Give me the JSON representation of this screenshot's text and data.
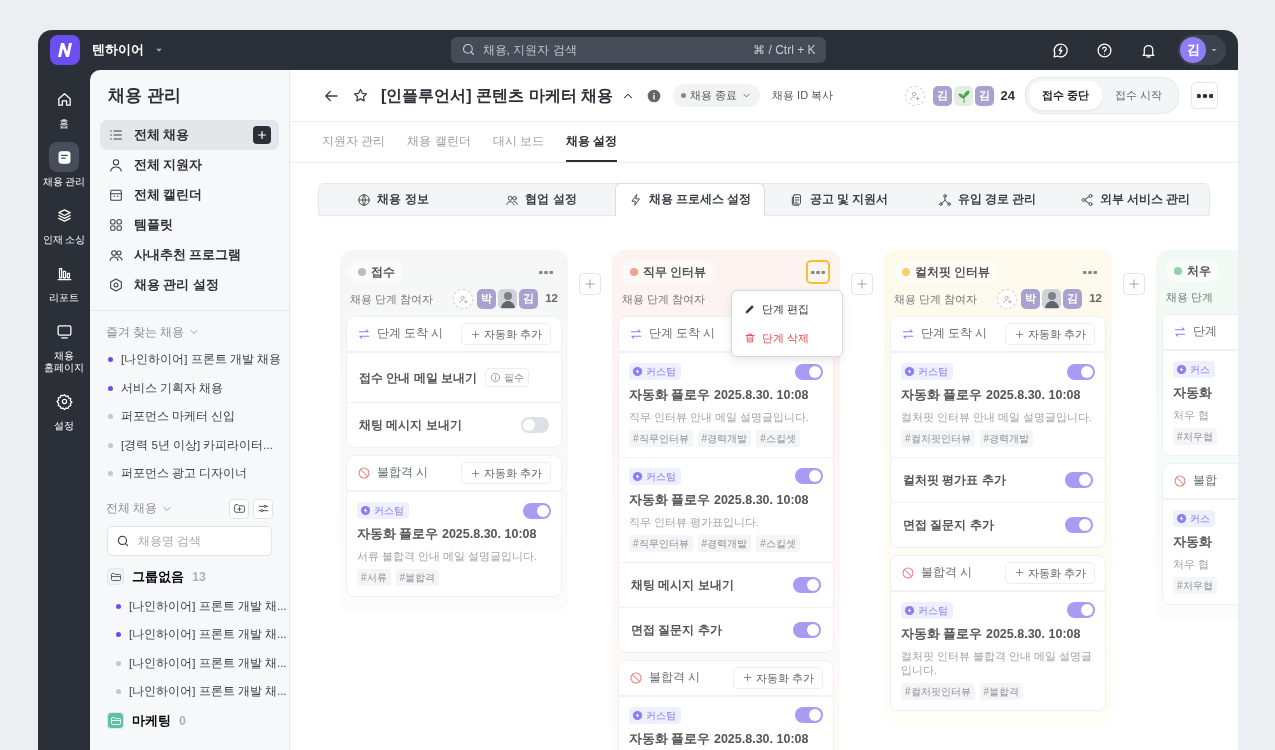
{
  "app": {
    "workspace": "텐하이어",
    "search_placeholder": "채용, 지원자 검색",
    "search_shortcut": "⌘ / Ctrl + K",
    "user_initial": "김"
  },
  "rail": [
    {
      "label": "홈",
      "selected": false
    },
    {
      "label": "채용 관리",
      "selected": true
    },
    {
      "label": "인재 소싱",
      "selected": false
    },
    {
      "label": "리포트",
      "selected": false
    },
    {
      "label": "채용 홈페이지",
      "selected": false
    },
    {
      "label": "설정",
      "selected": false
    }
  ],
  "sidebar": {
    "title": "채용 관리",
    "nav": [
      {
        "label": "전체 채용",
        "selected": true,
        "add": true
      },
      {
        "label": "전체 지원자",
        "selected": false,
        "add": false
      },
      {
        "label": "전체 캘린더",
        "selected": false,
        "add": false
      },
      {
        "label": "템플릿",
        "selected": false,
        "add": false
      },
      {
        "label": "사내추천 프로그램",
        "selected": false,
        "add": false
      },
      {
        "label": "채용 관리 설정",
        "selected": false,
        "add": false
      }
    ],
    "favorites_title": "즐겨 찾는 채용",
    "favorites": [
      {
        "label": "[나인하이어] 프론트 개발 채용",
        "color": "#6a4cf0"
      },
      {
        "label": "서비스 기획자 채용",
        "color": "#6a4cf0"
      },
      {
        "label": "퍼포먼스 마케터 신입",
        "color": "#c4c6cb"
      },
      {
        "label": "[경력 5년 이상] 카피라이터...",
        "color": "#c4c6cb"
      },
      {
        "label": "퍼포먼스 광고 디자이너",
        "color": "#c4c6cb"
      }
    ],
    "all_title": "전체 채용",
    "all_search_placeholder": "채용명 검색",
    "groups": [
      {
        "name": "그룹없음",
        "count": "13",
        "color": "#f1f2f4",
        "children": [
          {
            "label": "[나인하이어] 프론트 개발 채...",
            "color": "#6a4cf0"
          },
          {
            "label": "[나인하이어] 프론트 개발 채...",
            "color": "#6a4cf0"
          },
          {
            "label": "[나인하이어] 프론트 개발 채...",
            "color": "#c4c6cb"
          },
          {
            "label": "[나인하이어] 프론트 개발 채...",
            "color": "#c4c6cb"
          }
        ]
      },
      {
        "name": "마케팅",
        "count": "0",
        "color": "#5cc2a5"
      }
    ]
  },
  "header": {
    "title": "[인플루언서] 콘텐츠 마케터 채용",
    "status": "채용 종료",
    "copy_id": "채용 ID 복사",
    "members": [
      {
        "kind": "initial",
        "initial": "김"
      },
      {
        "kind": "sprout"
      },
      {
        "kind": "initial",
        "initial": "김"
      }
    ],
    "member_count": "24",
    "segments": [
      {
        "label": "접수 중단",
        "selected": true
      },
      {
        "label": "접수 시작",
        "selected": false
      }
    ]
  },
  "tabs": [
    {
      "label": "지원자 관리",
      "selected": false
    },
    {
      "label": "채용 캘린더",
      "selected": false
    },
    {
      "label": "대시 보드",
      "selected": false
    },
    {
      "label": "채용 설정",
      "selected": true
    }
  ],
  "subtabs": [
    {
      "label": "채용 정보",
      "selected": false
    },
    {
      "label": "협업 설정",
      "selected": false
    },
    {
      "label": "채용 프로세스 설정",
      "selected": true
    },
    {
      "label": "공고 및 지원서",
      "selected": false
    },
    {
      "label": "유입 경로 관리",
      "selected": false
    },
    {
      "label": "외부 서비스 관리",
      "selected": false
    }
  ],
  "stages": [
    {
      "name": "접수",
      "color": "#b9bcc2",
      "menu_open": false,
      "participants_label": "채용 단계 참여자",
      "avatars": [
        {
          "kind": "initial",
          "initial": "박"
        },
        {
          "kind": "photo"
        },
        {
          "kind": "initial",
          "initial": "김"
        }
      ],
      "participant_count": "12",
      "sections": [
        {
          "kind": "arrival",
          "label": "단계 도착 시",
          "add_label": "자동화 추가",
          "items": [
            {
              "kind": "required",
              "label": "접수 안내 메일 보내기",
              "badge": "필수"
            },
            {
              "kind": "simple",
              "label": "채팅 메시지 보내기",
              "on": false
            }
          ]
        },
        {
          "kind": "reject",
          "label": "불합격 시",
          "add_label": "자동화 추가",
          "items": [
            {
              "kind": "flow",
              "badge": "커스텀",
              "title": "자동화 플로우 2025.8.30. 10:08",
              "desc": "서류 불합격 안내 메일 설명글입니다.",
              "tags": [
                "#서류",
                "#불합격"
              ],
              "on": true
            }
          ]
        }
      ]
    },
    {
      "name": "직무 인터뷰",
      "color": "#f2a28e",
      "menu_open": true,
      "menu": [
        {
          "kind": "edit",
          "label": "단계 편집"
        },
        {
          "kind": "delete",
          "label": "단계 삭제"
        }
      ],
      "participants_label": "채용 단계 참여자",
      "sections": [
        {
          "kind": "arrival",
          "label": "단계 도착 시",
          "items": [
            {
              "kind": "flow",
              "badge": "커스텀",
              "title": "자동화 플로우 2025.8.30. 10:08",
              "desc": "직무 인터뷰 안내 메일 설명글입니다.",
              "tags": [
                "#직무인터뷰",
                "#경력개발",
                "#스킬셋"
              ],
              "on": true
            },
            {
              "kind": "flow",
              "badge": "커스텀",
              "title": "자동화 플로우 2025.8.30. 10:08",
              "desc": "직무 인터뷰 평가표입니다.",
              "tags": [
                "#직무인터뷰",
                "#경력개발",
                "#스킬셋"
              ],
              "on": true
            },
            {
              "kind": "simple",
              "label": "채팅 메시지 보내기",
              "on": true
            },
            {
              "kind": "simple",
              "label": "면접 질문지 추가",
              "on": true
            }
          ]
        },
        {
          "kind": "reject",
          "label": "불합격 시",
          "add_label": "자동화 추가",
          "items": [
            {
              "kind": "flow",
              "badge": "커스텀",
              "title": "자동화 플로우 2025.8.30. 10:08",
              "on": true
            }
          ]
        }
      ]
    },
    {
      "name": "컬처핏 인터뷰",
      "color": "#f2d36a",
      "menu_open": false,
      "participants_label": "채용 단계 참여자",
      "avatars": [
        {
          "kind": "initial",
          "initial": "박"
        },
        {
          "kind": "photo"
        },
        {
          "kind": "initial",
          "initial": "김"
        }
      ],
      "participant_count": "12",
      "sections": [
        {
          "kind": "arrival",
          "label": "단계 도착 시",
          "add_label": "자동화 추가",
          "items": [
            {
              "kind": "flow",
              "badge": "커스텀",
              "title": "자동화 플로우 2025.8.30. 10:08",
              "desc": "컬처핏 인터뷰 안내 메일 설명글입니다.",
              "tags": [
                "#컬처핏인터뷰",
                "#경력개발"
              ],
              "on": true
            },
            {
              "kind": "simple",
              "label": "컬처핏 평가표 추가",
              "on": true
            },
            {
              "kind": "simple",
              "label": "면접 질문지 추가",
              "on": true
            }
          ]
        },
        {
          "kind": "reject",
          "label": "불합격 시",
          "add_label": "자동화 추가",
          "items": [
            {
              "kind": "flow",
              "badge": "커스텀",
              "title": "자동화 플로우 2025.8.30. 10:08",
              "desc": "컬처핏 인터뷰 불합격 안내 메일 설명글입니다.",
              "tags": [
                "#컬처핏인터뷰",
                "#불합격"
              ],
              "on": true
            }
          ]
        }
      ]
    },
    {
      "name": "처우",
      "color": "#8fd3a9",
      "participants_label": "채용 단계",
      "sections": [
        {
          "kind": "arrival",
          "label": "단계",
          "items": [
            {
              "kind": "flow",
              "badge": "커스",
              "title": "자동화",
              "desc": "처우 협",
              "tags": [
                "#처우협"
              ]
            }
          ]
        },
        {
          "kind": "reject",
          "label": "불합",
          "items": [
            {
              "kind": "flow",
              "badge": "커스",
              "title": "자동화",
              "desc": "처우 협",
              "tags": [
                "#처우협"
              ]
            }
          ]
        }
      ]
    }
  ]
}
